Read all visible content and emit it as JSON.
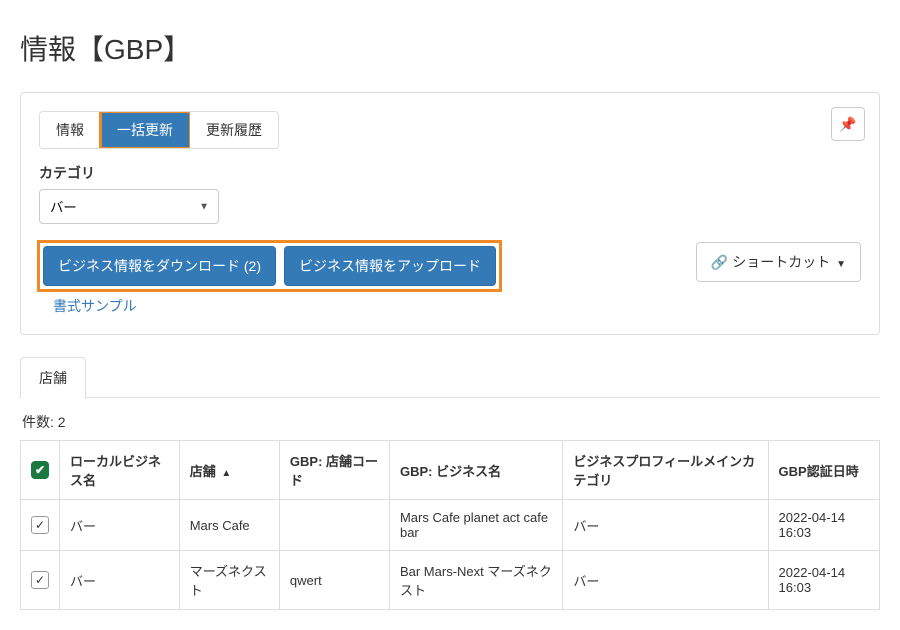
{
  "page_title": "情報【GBP】",
  "tabs": {
    "info": "情報",
    "bulk": "一括更新",
    "history": "更新履歴"
  },
  "category": {
    "label": "カテゴリ",
    "value": "バー"
  },
  "buttons": {
    "download": "ビジネス情報をダウンロード (2)",
    "upload": "ビジネス情報をアップロード",
    "shortcut": "ショートカット"
  },
  "links": {
    "format_sample": "書式サンプル"
  },
  "shop_tab": "店舗",
  "count_label": "件数: 2",
  "table": {
    "headers": {
      "local_name": "ローカルビジネス名",
      "shop": "店舗",
      "gbp_code": "GBP: 店舗コード",
      "gbp_name": "GBP: ビジネス名",
      "main_category": "ビジネスプロフィールメインカテゴリ",
      "cert_date": "GBP認証日時"
    },
    "rows": [
      {
        "local_name": "バー",
        "shop": "Mars Cafe",
        "gbp_code": "",
        "gbp_name": "Mars Cafe planet act cafe bar",
        "main_category": "バー",
        "cert_date": "2022-04-14 16:03"
      },
      {
        "local_name": "バー",
        "shop": "マーズネクスト",
        "gbp_code": "qwert",
        "gbp_name": "Bar Mars-Next マーズネクスト",
        "main_category": "バー",
        "cert_date": "2022-04-14 16:03"
      }
    ]
  }
}
